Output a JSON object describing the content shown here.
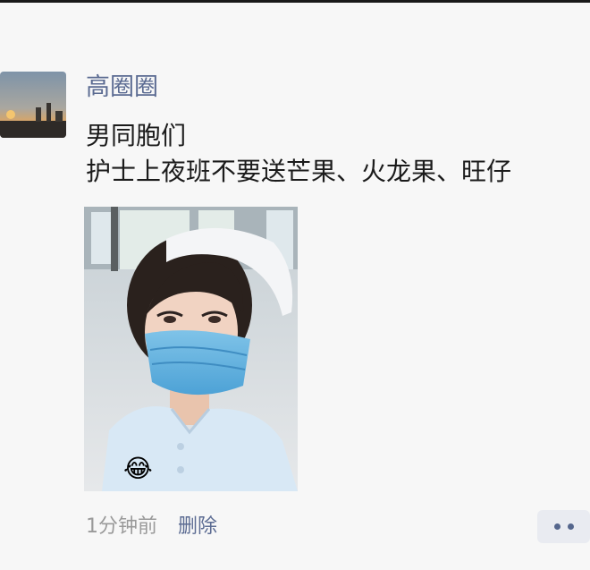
{
  "post": {
    "author": "高圈圈",
    "text_lines": [
      "男同胞们",
      "护士上夜班不要送芒果、火龙果、旺仔"
    ],
    "photo": {
      "emoji": "😂"
    },
    "timestamp": "1分钟前",
    "delete_label": "删除",
    "more_icon": "more-dots-icon"
  },
  "colors": {
    "link": "#5b6b92",
    "text": "#1b1b1b",
    "muted": "#9a9a9a",
    "background": "#f7f7f7"
  }
}
